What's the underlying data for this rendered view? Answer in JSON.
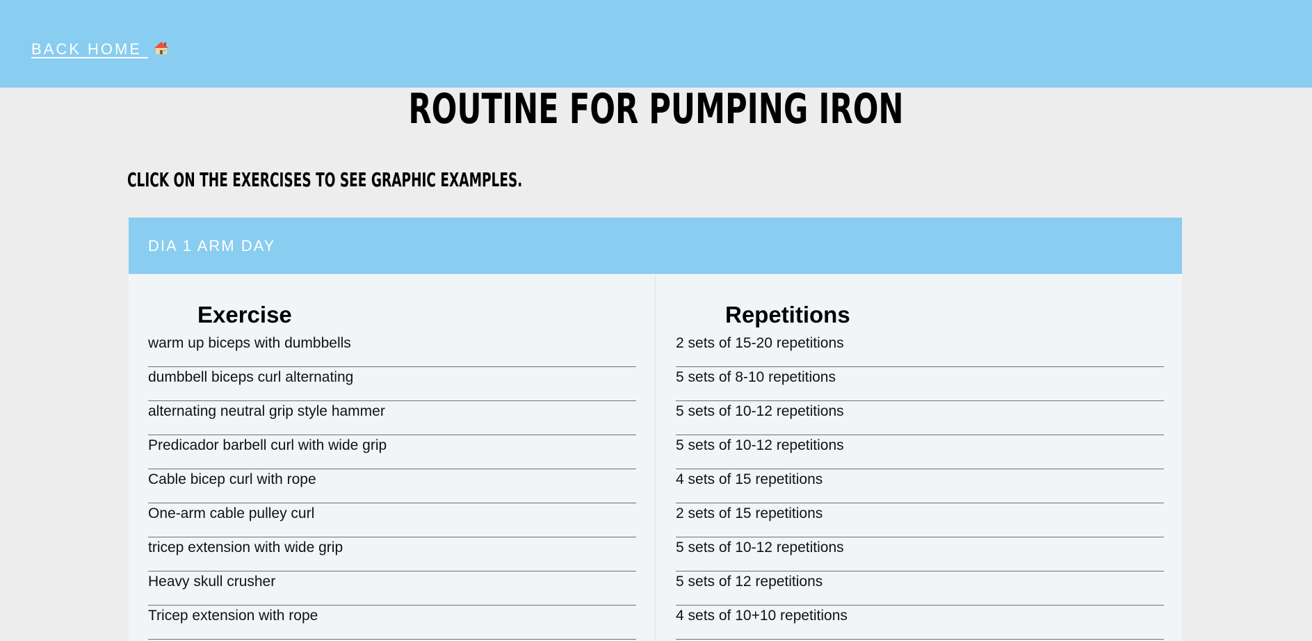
{
  "nav": {
    "back_home_label": "BACK HOME",
    "back_home_icon": "house-icon"
  },
  "page": {
    "title": "ROUTINE FOR PUMPING IRON",
    "subtitle": "CLICK ON THE EXERCISES TO SEE GRAPHIC EXAMPLES."
  },
  "routine": {
    "header": "DIA 1 ARM DAY",
    "columns": {
      "exercise": "Exercise",
      "repetitions": "Repetitions"
    },
    "rows": [
      {
        "exercise": "warm up biceps with dumbbells",
        "repetitions": "2 sets of 15-20 repetitions"
      },
      {
        "exercise": "dumbbell biceps curl alternating",
        "repetitions": "5 sets of 8-10 repetitions"
      },
      {
        "exercise": "alternating neutral grip style hammer",
        "repetitions": "5 sets of 10-12 repetitions"
      },
      {
        "exercise": "Predicador barbell curl with wide grip",
        "repetitions": "5 sets of 10-12 repetitions"
      },
      {
        "exercise": "Cable bicep curl with rope",
        "repetitions": "4 sets of 15 repetitions"
      },
      {
        "exercise": "One-arm cable pulley curl",
        "repetitions": "2 sets of 15 repetitions"
      },
      {
        "exercise": "tricep extension with wide grip",
        "repetitions": "5 sets of 10-12 repetitions"
      },
      {
        "exercise": "Heavy skull crusher",
        "repetitions": "5 sets of 12 repetitions"
      },
      {
        "exercise": "Tricep extension with rope",
        "repetitions": "4 sets of 10+10 repetitions"
      }
    ]
  },
  "colors": {
    "accent": "#89cdf1",
    "background": "#ededed",
    "card": "#f2f5f7"
  }
}
